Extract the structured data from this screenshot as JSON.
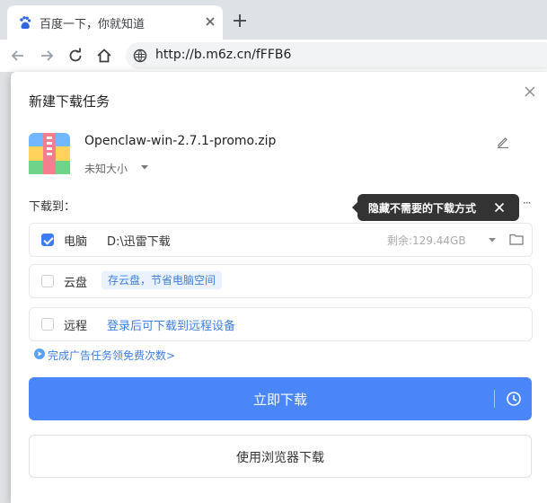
{
  "browser": {
    "tab_title": "百度一下，你就知道",
    "url": "http://b.m6z.cn/fFFB6"
  },
  "dialog": {
    "title": "新建下载任务",
    "file": {
      "name": "Openclaw-win-2.7.1-promo.zip",
      "size": "未知大小"
    },
    "dest_label": "下载到：",
    "tooltip": "隐藏不需要的下载方式",
    "more": "···",
    "options": {
      "pc": {
        "label": "电脑",
        "path": "D:\\迅雷下载",
        "free": "剩余:129.44GB",
        "checked": true
      },
      "cloud": {
        "label": "云盘",
        "tag": "存云盘，节省电脑空间",
        "checked": false
      },
      "remote": {
        "label": "远程",
        "link": "登录后可下载到远程设备",
        "checked": false
      }
    },
    "ad_link": "完成广告任务领免费次数>",
    "primary_button": "立即下载",
    "secondary_button": "使用浏览器下载"
  },
  "colors": {
    "accent": "#4a86f7",
    "link": "#3f7fe0",
    "tooltip_bg": "#333333"
  }
}
